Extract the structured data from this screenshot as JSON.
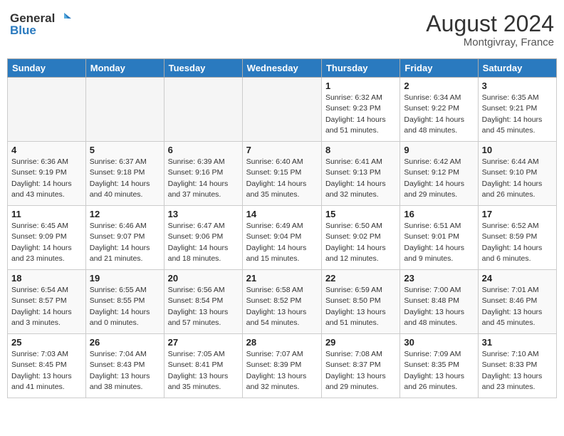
{
  "header": {
    "logo_general": "General",
    "logo_blue": "Blue",
    "month_year": "August 2024",
    "location": "Montgivray, France"
  },
  "days_of_week": [
    "Sunday",
    "Monday",
    "Tuesday",
    "Wednesday",
    "Thursday",
    "Friday",
    "Saturday"
  ],
  "weeks": [
    [
      {
        "day": "",
        "info": ""
      },
      {
        "day": "",
        "info": ""
      },
      {
        "day": "",
        "info": ""
      },
      {
        "day": "",
        "info": ""
      },
      {
        "day": "1",
        "info": "Sunrise: 6:32 AM\nSunset: 9:23 PM\nDaylight: 14 hours and 51 minutes."
      },
      {
        "day": "2",
        "info": "Sunrise: 6:34 AM\nSunset: 9:22 PM\nDaylight: 14 hours and 48 minutes."
      },
      {
        "day": "3",
        "info": "Sunrise: 6:35 AM\nSunset: 9:21 PM\nDaylight: 14 hours and 45 minutes."
      }
    ],
    [
      {
        "day": "4",
        "info": "Sunrise: 6:36 AM\nSunset: 9:19 PM\nDaylight: 14 hours and 43 minutes."
      },
      {
        "day": "5",
        "info": "Sunrise: 6:37 AM\nSunset: 9:18 PM\nDaylight: 14 hours and 40 minutes."
      },
      {
        "day": "6",
        "info": "Sunrise: 6:39 AM\nSunset: 9:16 PM\nDaylight: 14 hours and 37 minutes."
      },
      {
        "day": "7",
        "info": "Sunrise: 6:40 AM\nSunset: 9:15 PM\nDaylight: 14 hours and 35 minutes."
      },
      {
        "day": "8",
        "info": "Sunrise: 6:41 AM\nSunset: 9:13 PM\nDaylight: 14 hours and 32 minutes."
      },
      {
        "day": "9",
        "info": "Sunrise: 6:42 AM\nSunset: 9:12 PM\nDaylight: 14 hours and 29 minutes."
      },
      {
        "day": "10",
        "info": "Sunrise: 6:44 AM\nSunset: 9:10 PM\nDaylight: 14 hours and 26 minutes."
      }
    ],
    [
      {
        "day": "11",
        "info": "Sunrise: 6:45 AM\nSunset: 9:09 PM\nDaylight: 14 hours and 23 minutes."
      },
      {
        "day": "12",
        "info": "Sunrise: 6:46 AM\nSunset: 9:07 PM\nDaylight: 14 hours and 21 minutes."
      },
      {
        "day": "13",
        "info": "Sunrise: 6:47 AM\nSunset: 9:06 PM\nDaylight: 14 hours and 18 minutes."
      },
      {
        "day": "14",
        "info": "Sunrise: 6:49 AM\nSunset: 9:04 PM\nDaylight: 14 hours and 15 minutes."
      },
      {
        "day": "15",
        "info": "Sunrise: 6:50 AM\nSunset: 9:02 PM\nDaylight: 14 hours and 12 minutes."
      },
      {
        "day": "16",
        "info": "Sunrise: 6:51 AM\nSunset: 9:01 PM\nDaylight: 14 hours and 9 minutes."
      },
      {
        "day": "17",
        "info": "Sunrise: 6:52 AM\nSunset: 8:59 PM\nDaylight: 14 hours and 6 minutes."
      }
    ],
    [
      {
        "day": "18",
        "info": "Sunrise: 6:54 AM\nSunset: 8:57 PM\nDaylight: 14 hours and 3 minutes."
      },
      {
        "day": "19",
        "info": "Sunrise: 6:55 AM\nSunset: 8:55 PM\nDaylight: 14 hours and 0 minutes."
      },
      {
        "day": "20",
        "info": "Sunrise: 6:56 AM\nSunset: 8:54 PM\nDaylight: 13 hours and 57 minutes."
      },
      {
        "day": "21",
        "info": "Sunrise: 6:58 AM\nSunset: 8:52 PM\nDaylight: 13 hours and 54 minutes."
      },
      {
        "day": "22",
        "info": "Sunrise: 6:59 AM\nSunset: 8:50 PM\nDaylight: 13 hours and 51 minutes."
      },
      {
        "day": "23",
        "info": "Sunrise: 7:00 AM\nSunset: 8:48 PM\nDaylight: 13 hours and 48 minutes."
      },
      {
        "day": "24",
        "info": "Sunrise: 7:01 AM\nSunset: 8:46 PM\nDaylight: 13 hours and 45 minutes."
      }
    ],
    [
      {
        "day": "25",
        "info": "Sunrise: 7:03 AM\nSunset: 8:45 PM\nDaylight: 13 hours and 41 minutes."
      },
      {
        "day": "26",
        "info": "Sunrise: 7:04 AM\nSunset: 8:43 PM\nDaylight: 13 hours and 38 minutes."
      },
      {
        "day": "27",
        "info": "Sunrise: 7:05 AM\nSunset: 8:41 PM\nDaylight: 13 hours and 35 minutes."
      },
      {
        "day": "28",
        "info": "Sunrise: 7:07 AM\nSunset: 8:39 PM\nDaylight: 13 hours and 32 minutes."
      },
      {
        "day": "29",
        "info": "Sunrise: 7:08 AM\nSunset: 8:37 PM\nDaylight: 13 hours and 29 minutes."
      },
      {
        "day": "30",
        "info": "Sunrise: 7:09 AM\nSunset: 8:35 PM\nDaylight: 13 hours and 26 minutes."
      },
      {
        "day": "31",
        "info": "Sunrise: 7:10 AM\nSunset: 8:33 PM\nDaylight: 13 hours and 23 minutes."
      }
    ]
  ]
}
